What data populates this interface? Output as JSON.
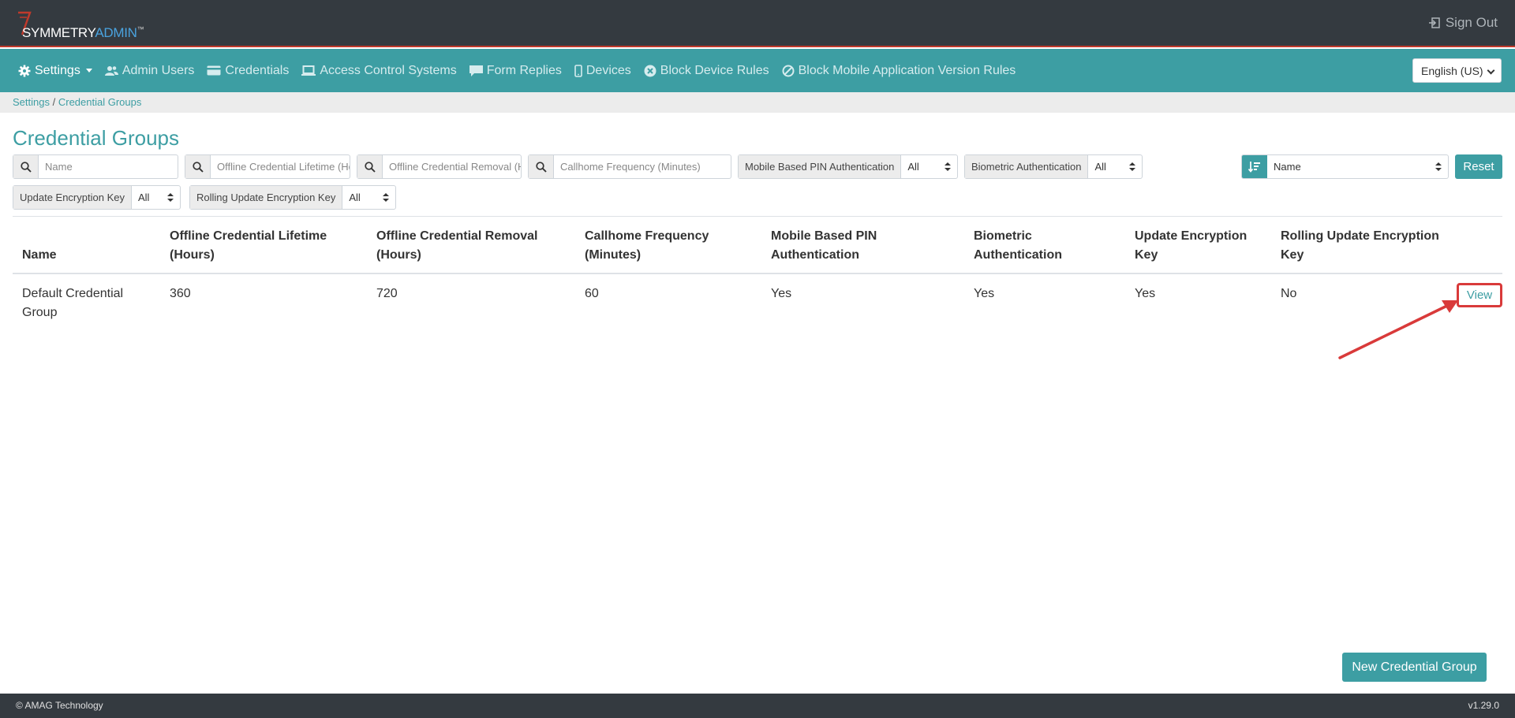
{
  "header": {
    "logo_primary": "SYMMETRY",
    "logo_secondary": "ADMIN",
    "logo_tm": "™",
    "signout_label": "Sign Out"
  },
  "nav": {
    "items": [
      {
        "label": "Settings",
        "icon": "gear-icon"
      },
      {
        "label": "Admin Users",
        "icon": "users-icon"
      },
      {
        "label": "Credentials",
        "icon": "card-icon"
      },
      {
        "label": "Access Control Systems",
        "icon": "laptop-icon"
      },
      {
        "label": "Form Replies",
        "icon": "comment-icon"
      },
      {
        "label": "Devices",
        "icon": "mobile-icon"
      },
      {
        "label": "Block Device Rules",
        "icon": "circle-x-icon"
      },
      {
        "label": "Block Mobile Application Version Rules",
        "icon": "ban-icon"
      }
    ],
    "language": "English (US)"
  },
  "breadcrumb": {
    "parent": "Settings",
    "separator": "/",
    "current": "Credential Groups"
  },
  "page": {
    "title": "Credential Groups"
  },
  "filters": {
    "search_name": "Name",
    "search_lifetime": "Offline Credential Lifetime (Hours)",
    "search_removal": "Offline Credential Removal (Hours)",
    "search_callhome": "Callhome Frequency (Minutes)",
    "mobile_pin_label": "Mobile Based PIN Authentication",
    "mobile_pin_value": "All",
    "biometric_label": "Biometric Authentication",
    "biometric_value": "All",
    "update_key_label": "Update Encryption Key",
    "update_key_value": "All",
    "rolling_key_label": "Rolling Update Encryption Key",
    "rolling_key_value": "All",
    "sort_value": "Name",
    "reset_label": "Reset"
  },
  "table": {
    "columns": [
      [
        "Name"
      ],
      [
        "Offline Credential Lifetime",
        "(Hours)"
      ],
      [
        "Offline Credential Removal",
        "(Hours)"
      ],
      [
        "Callhome Frequency",
        "(Minutes)"
      ],
      [
        "Mobile Based PIN",
        "Authentication"
      ],
      [
        "Biometric",
        "Authentication"
      ],
      [
        "Update Encryption",
        "Key"
      ],
      [
        "Rolling Update Encryption",
        "Key"
      ]
    ],
    "rows": [
      {
        "name": [
          "Default Credential",
          "Group"
        ],
        "lifetime": "360",
        "removal": "720",
        "callhome": "60",
        "mobile_pin": "Yes",
        "biometric": "Yes",
        "update_key": "Yes",
        "rolling_key": "No",
        "action": "View"
      }
    ]
  },
  "actions": {
    "new_label": "New Credential Group"
  },
  "footer": {
    "copyright": "© AMAG Technology",
    "version": "v1.29.0"
  },
  "colors": {
    "teal": "#3d9ea3",
    "dark": "#343a40",
    "highlight": "#d93a3a"
  }
}
